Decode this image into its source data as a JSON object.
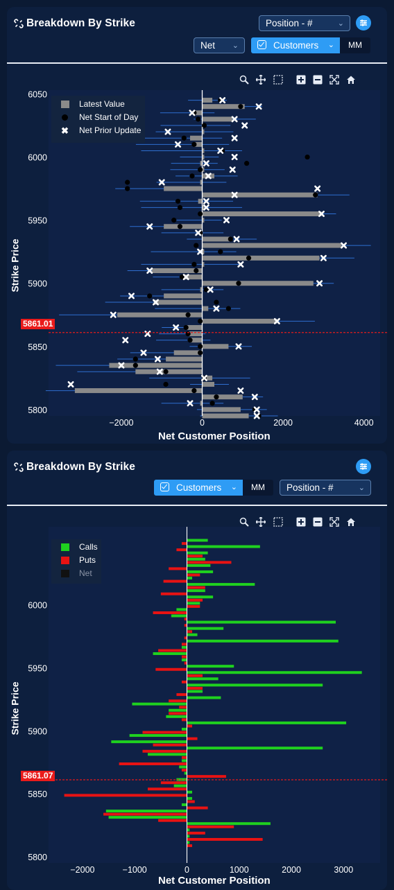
{
  "panel1": {
    "title": "Breakdown By Strike",
    "position_select": "Position - #",
    "net_select": "Net",
    "customers_button": "Customers",
    "mm_button": "MM",
    "toolbar": [
      "zoom-in-icon",
      "pan-icon",
      "box-select-icon",
      "plus-icon",
      "minus-icon",
      "autoscale-icon",
      "home-icon"
    ],
    "spot_label": "5861.01",
    "legend": [
      {
        "label": "Latest Value",
        "color": "#8a8a8a"
      },
      {
        "label": "Net Start of Day",
        "color": "#000000"
      },
      {
        "label": "Net Prior Update",
        "color": "#ffffff"
      }
    ]
  },
  "panel2": {
    "title": "Breakdown By Strike",
    "customers_button": "Customers",
    "mm_button": "MM",
    "position_select": "Position - #",
    "toolbar": [
      "zoom-in-icon",
      "pan-icon",
      "box-select-icon",
      "plus-icon",
      "minus-icon",
      "autoscale-icon",
      "home-icon"
    ],
    "spot_label": "5861.07",
    "legend": [
      {
        "label": "Calls",
        "color": "#1fd11f"
      },
      {
        "label": "Puts",
        "color": "#e81313"
      },
      {
        "label": "Net",
        "color": "#111111"
      }
    ]
  },
  "chart_data": [
    {
      "type": "bar",
      "orientation": "horizontal",
      "ylabel": "Strike Price",
      "xlabel": "Net Customer Position",
      "xlim": [
        -3800,
        4400
      ],
      "ylim": [
        5795,
        6053
      ],
      "xticks": [
        -2000,
        0,
        2000,
        4000
      ],
      "yticks": [
        5800,
        5850,
        5900,
        5950,
        6000,
        6050
      ],
      "spot": 5861.01,
      "legend_position": "top-left",
      "series": [
        {
          "name": "Latest Value",
          "data": [
            [
              6045,
              250
            ],
            [
              6040,
              1050
            ],
            [
              6035,
              -200
            ],
            [
              6030,
              750
            ],
            [
              6025,
              50
            ],
            [
              6020,
              50
            ],
            [
              6015,
              -300
            ],
            [
              6010,
              -200
            ],
            [
              6005,
              50
            ],
            [
              6000,
              50
            ],
            [
              5995,
              -50
            ],
            [
              5990,
              50
            ],
            [
              5985,
              300
            ],
            [
              5980,
              -50
            ],
            [
              5975,
              -950
            ],
            [
              5970,
              2850
            ],
            [
              5965,
              -100
            ],
            [
              5960,
              50
            ],
            [
              5955,
              2950
            ],
            [
              5950,
              50
            ],
            [
              5945,
              -950
            ],
            [
              5940,
              -50
            ],
            [
              5935,
              700
            ],
            [
              5930,
              3450
            ],
            [
              5925,
              50
            ],
            [
              5920,
              2900
            ],
            [
              5915,
              50
            ],
            [
              5910,
              -1250
            ],
            [
              5905,
              -500
            ],
            [
              5900,
              2750
            ],
            [
              5895,
              -50
            ],
            [
              5890,
              -950
            ],
            [
              5885,
              -1200
            ],
            [
              5880,
              150
            ],
            [
              5875,
              -2100
            ],
            [
              5870,
              1850
            ],
            [
              5865,
              -400
            ],
            [
              5860,
              -350
            ],
            [
              5855,
              -300
            ],
            [
              5850,
              650
            ],
            [
              5845,
              -700
            ],
            [
              5840,
              -900
            ],
            [
              5835,
              -2300
            ],
            [
              5830,
              -1650
            ],
            [
              5825,
              250
            ],
            [
              5820,
              300
            ],
            [
              5815,
              -3150
            ],
            [
              5810,
              1000
            ],
            [
              5805,
              -50
            ],
            [
              5800,
              950
            ],
            [
              5795,
              1150
            ]
          ]
        },
        {
          "name": "Net Start of Day",
          "data": [
            [
              6045,
              450
            ],
            [
              6040,
              950
            ],
            [
              6035,
              -200
            ],
            [
              6030,
              -100
            ],
            [
              6025,
              50
            ],
            [
              6020,
              -1500
            ],
            [
              6015,
              -450
            ],
            [
              6010,
              -200
            ],
            [
              6005,
              500
            ],
            [
              6000,
              2600
            ],
            [
              5995,
              1100
            ],
            [
              5990,
              -50
            ],
            [
              5985,
              -250
            ],
            [
              5980,
              -1850
            ],
            [
              5975,
              -1850
            ],
            [
              5970,
              2800
            ],
            [
              5965,
              -600
            ],
            [
              5960,
              -550
            ],
            [
              5955,
              -50
            ],
            [
              5950,
              -700
            ],
            [
              5945,
              -550
            ],
            [
              5940,
              -50
            ],
            [
              5935,
              700
            ],
            [
              5930,
              -150
            ],
            [
              5925,
              450
            ],
            [
              5920,
              1150
            ],
            [
              5915,
              -200
            ],
            [
              5910,
              -150
            ],
            [
              5905,
              -500
            ],
            [
              5900,
              900
            ],
            [
              5895,
              100
            ],
            [
              5890,
              -1300
            ],
            [
              5885,
              350
            ],
            [
              5880,
              650
            ],
            [
              5875,
              -350
            ],
            [
              5870,
              -50
            ],
            [
              5865,
              -400
            ],
            [
              5860,
              -350
            ],
            [
              5855,
              -300
            ],
            [
              5850,
              -50
            ],
            [
              5845,
              -50
            ],
            [
              5840,
              -1650
            ],
            [
              5835,
              -1650
            ],
            [
              5830,
              -900
            ],
            [
              5825,
              50
            ],
            [
              5820,
              -900
            ],
            [
              5815,
              -200
            ],
            [
              5810,
              350
            ],
            [
              5805,
              250
            ],
            [
              5800,
              1300
            ],
            [
              5795,
              1400
            ]
          ]
        },
        {
          "name": "Net Prior Update",
          "data": [
            [
              6045,
              500
            ],
            [
              6040,
              1400
            ],
            [
              6035,
              -250
            ],
            [
              6030,
              800
            ],
            [
              6025,
              1050
            ],
            [
              6020,
              -850
            ],
            [
              6015,
              800
            ],
            [
              6010,
              -600
            ],
            [
              6005,
              450
            ],
            [
              6000,
              800
            ],
            [
              5995,
              100
            ],
            [
              5990,
              750
            ],
            [
              5985,
              150
            ],
            [
              5980,
              -1000
            ],
            [
              5975,
              2850
            ],
            [
              5970,
              800
            ],
            [
              5965,
              100
            ],
            [
              5960,
              100
            ],
            [
              5955,
              2950
            ],
            [
              5950,
              600
            ],
            [
              5945,
              -1300
            ],
            [
              5940,
              -100
            ],
            [
              5935,
              850
            ],
            [
              5930,
              3500
            ],
            [
              5925,
              -50
            ],
            [
              5920,
              3000
            ],
            [
              5915,
              950
            ],
            [
              5910,
              -1300
            ],
            [
              5905,
              -400
            ],
            [
              5900,
              2900
            ],
            [
              5895,
              200
            ],
            [
              5890,
              -1750
            ],
            [
              5885,
              -1150
            ],
            [
              5880,
              350
            ],
            [
              5875,
              -2200
            ],
            [
              5870,
              1850
            ],
            [
              5865,
              -650
            ],
            [
              5860,
              -1350
            ],
            [
              5855,
              -1900
            ],
            [
              5850,
              900
            ],
            [
              5845,
              -1450
            ],
            [
              5840,
              -1100
            ],
            [
              5835,
              -2000
            ],
            [
              5830,
              -1050
            ],
            [
              5825,
              50
            ],
            [
              5820,
              -3250
            ],
            [
              5815,
              950
            ],
            [
              5810,
              1300
            ],
            [
              5805,
              -300
            ],
            [
              5800,
              1350
            ],
            [
              5795,
              1350
            ]
          ]
        }
      ]
    },
    {
      "type": "bar",
      "orientation": "horizontal",
      "ylabel": "Strike Price",
      "xlabel": "Net Customer Position",
      "xlim": [
        -2650,
        3700
      ],
      "ylim": [
        5795,
        6062
      ],
      "xticks": [
        -2000,
        -1000,
        0,
        1000,
        2000,
        3000
      ],
      "yticks": [
        5800,
        5850,
        5900,
        5950,
        6000
      ],
      "spot": 5861.07,
      "legend_position": "top-left",
      "series": [
        {
          "name": "Calls",
          "values": [
            [
              6050,
              400
            ],
            [
              6045,
              1400
            ],
            [
              6040,
              400
            ],
            [
              6035,
              350
            ],
            [
              6030,
              450
            ],
            [
              6025,
              500
            ],
            [
              6020,
              100
            ],
            [
              6015,
              1300
            ],
            [
              6010,
              350
            ],
            [
              6005,
              500
            ],
            [
              6000,
              250
            ],
            [
              5995,
              -200
            ],
            [
              5990,
              -300
            ],
            [
              5985,
              2850
            ],
            [
              5980,
              700
            ],
            [
              5975,
              200
            ],
            [
              5970,
              2900
            ],
            [
              5965,
              -100
            ],
            [
              5960,
              -650
            ],
            [
              5955,
              -100
            ],
            [
              5950,
              900
            ],
            [
              5945,
              3350
            ],
            [
              5940,
              600
            ],
            [
              5935,
              2600
            ],
            [
              5930,
              300
            ],
            [
              5925,
              650
            ],
            [
              5920,
              -1050
            ],
            [
              5915,
              -350
            ],
            [
              5910,
              -400
            ],
            [
              5905,
              3050
            ],
            [
              5900,
              -100
            ],
            [
              5895,
              -1100
            ],
            [
              5890,
              -1450
            ],
            [
              5885,
              2600
            ],
            [
              5880,
              -750
            ],
            [
              5875,
              -100
            ],
            [
              5870,
              -150
            ],
            [
              5865,
              -50
            ],
            [
              5860,
              -200
            ],
            [
              5855,
              -250
            ],
            [
              5850,
              100
            ],
            [
              5845,
              100
            ],
            [
              5840,
              -100
            ],
            [
              5835,
              -1550
            ],
            [
              5830,
              -1500
            ],
            [
              5825,
              1600
            ],
            [
              5820,
              50
            ],
            [
              5815,
              50
            ],
            [
              5810,
              50
            ]
          ]
        },
        {
          "name": "Puts",
          "values": [
            [
              6050,
              -100
            ],
            [
              6045,
              -200
            ],
            [
              6040,
              300
            ],
            [
              6035,
              850
            ],
            [
              6030,
              -350
            ],
            [
              6025,
              250
            ],
            [
              6020,
              -450
            ],
            [
              6015,
              350
            ],
            [
              6010,
              -500
            ],
            [
              6005,
              300
            ],
            [
              6000,
              250
            ],
            [
              5995,
              -650
            ],
            [
              5990,
              -50
            ],
            [
              5985,
              -50
            ],
            [
              5980,
              100
            ],
            [
              5975,
              -50
            ],
            [
              5970,
              -100
            ],
            [
              5965,
              -550
            ],
            [
              5960,
              -100
            ],
            [
              5955,
              -50
            ],
            [
              5950,
              -600
            ],
            [
              5945,
              300
            ],
            [
              5940,
              -100
            ],
            [
              5935,
              300
            ],
            [
              5930,
              -200
            ],
            [
              5925,
              -350
            ],
            [
              5920,
              -150
            ],
            [
              5915,
              -350
            ],
            [
              5910,
              -100
            ],
            [
              5905,
              100
            ],
            [
              5900,
              -850
            ],
            [
              5895,
              200
            ],
            [
              5890,
              -650
            ],
            [
              5885,
              -850
            ],
            [
              5880,
              -100
            ],
            [
              5875,
              -1300
            ],
            [
              5870,
              -100
            ],
            [
              5865,
              750
            ],
            [
              5860,
              -500
            ],
            [
              5855,
              -750
            ],
            [
              5850,
              -2350
            ],
            [
              5845,
              150
            ],
            [
              5840,
              400
            ],
            [
              5835,
              -1600
            ],
            [
              5830,
              -550
            ],
            [
              5825,
              900
            ],
            [
              5820,
              350
            ],
            [
              5815,
              1450
            ],
            [
              5810,
              100
            ]
          ]
        },
        {
          "name": "Net",
          "values": []
        }
      ]
    }
  ]
}
